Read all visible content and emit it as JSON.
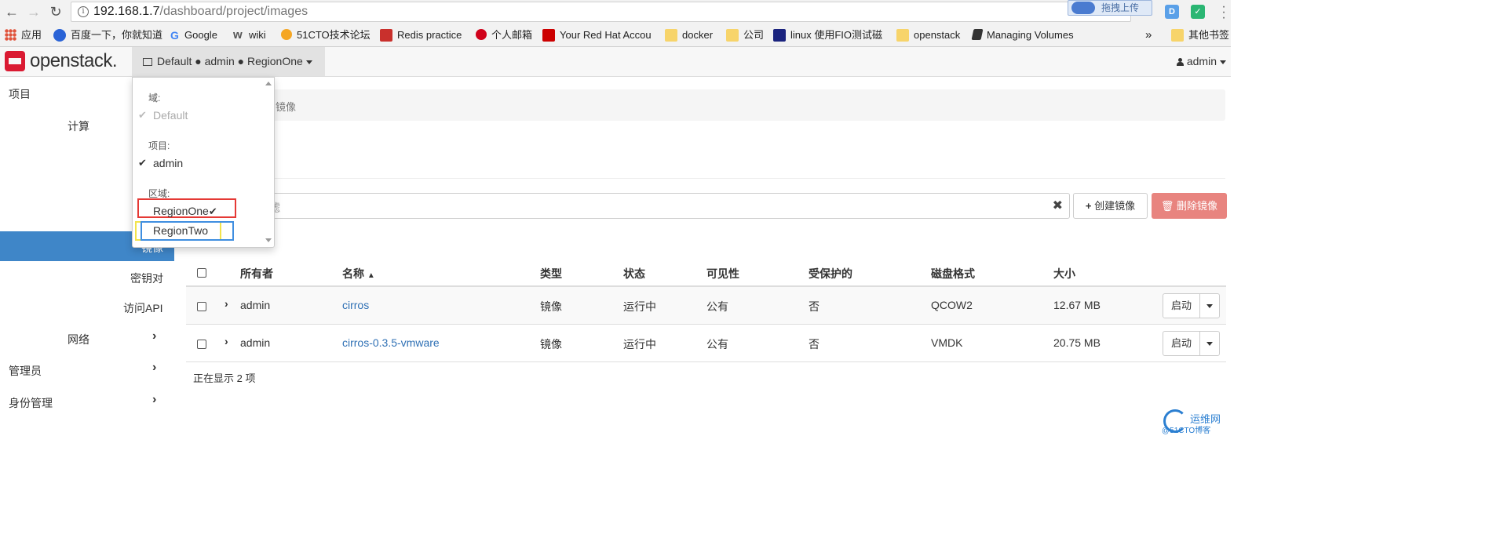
{
  "browser": {
    "url_host": "192.168.1.7",
    "url_path": "/dashboard/project/images",
    "upload_label": "拖拽上传",
    "ext_icons": [
      {
        "name": "d-extension-icon",
        "label": "D",
        "color": "#5aa0e8"
      },
      {
        "name": "green-extension-icon",
        "label": "✓",
        "color": "#2bb673"
      }
    ]
  },
  "bookmarks": [
    {
      "label": "应用",
      "icon": "apps-grid-icon",
      "color": "#e0533b"
    },
    {
      "label": "百度一下，你就知道",
      "icon": "baidu-paw-icon",
      "color": "#2a63d6"
    },
    {
      "label": "Google",
      "icon": "google-icon",
      "color": "#4285f4"
    },
    {
      "label": "wiki",
      "icon": "wiki-icon",
      "color": "#666666"
    },
    {
      "label": "51CTO技术论坛",
      "icon": "51cto-icon",
      "color": "#f5a623"
    },
    {
      "label": "Redis practice",
      "icon": "redis-icon",
      "color": "#c9302c"
    },
    {
      "label": "个人邮箱",
      "icon": "mail-icon",
      "color": "#d0021b"
    },
    {
      "label": "Your Red Hat Accou",
      "icon": "redhat-icon",
      "color": "#cc0000"
    },
    {
      "label": "docker",
      "icon": "folder-icon",
      "color": "#f7d46a"
    },
    {
      "label": "公司",
      "icon": "folder-icon",
      "color": "#f7d46a"
    },
    {
      "label": "linux 使用FIO测试磁",
      "icon": "site-icon",
      "color": "#1a237e"
    },
    {
      "label": "openstack",
      "icon": "folder-icon",
      "color": "#f7d46a"
    },
    {
      "label": "Managing Volumes",
      "icon": "book-icon",
      "color": "#333333"
    }
  ],
  "bookmarks_more": "»",
  "bookmarks_other": "其他书签",
  "header": {
    "logo_text": "openstack.",
    "context_label": "Default ● admin ● RegionOne",
    "user_label": "admin"
  },
  "sidebar": {
    "project": "项目",
    "compute": "计算",
    "images_partial": "镜像",
    "keypairs": "密钥对",
    "access_api": "访问API",
    "network": "网络",
    "admin": "管理员",
    "identity": "身份管理"
  },
  "dropdown": {
    "domain_header": "域:",
    "domain_item": "Default",
    "project_header": "项目:",
    "project_item": "admin",
    "region_header": "区域:",
    "region_one": "RegionOne",
    "region_two": "RegionTwo",
    "highlight_colors": {
      "red": "#e53935",
      "yellow": "#f3e34a",
      "blue": "#3f8ee0"
    }
  },
  "main": {
    "breadcrumb_partial": "镜像",
    "filter_placeholder_partial": "滤",
    "create_button": "创建镜像",
    "delete_button": "删除镜像",
    "showing_text": "正在显示 2 项",
    "columns": {
      "owner": "所有者",
      "name": "名称",
      "type": "类型",
      "status": "状态",
      "visibility": "可见性",
      "protected": "受保护的",
      "disk_format": "磁盘格式",
      "size": "大小"
    },
    "rows": [
      {
        "owner": "admin",
        "name": "cirros",
        "type": "镜像",
        "status": "运行中",
        "visibility": "公有",
        "protected": "否",
        "disk_format": "QCOW2",
        "size": "12.67 MB",
        "action": "启动"
      },
      {
        "owner": "admin",
        "name": "cirros-0.3.5-vmware",
        "type": "镜像",
        "status": "运行中",
        "visibility": "公有",
        "protected": "否",
        "disk_format": "VMDK",
        "size": "20.75 MB",
        "action": "启动"
      }
    ]
  },
  "watermark": {
    "title": "运维网",
    "sub": "@51CTO博客"
  },
  "colors": {
    "accent": "#3f86c8",
    "danger": "#e8847f",
    "link": "#3071b5",
    "brand": "#da1a32"
  }
}
